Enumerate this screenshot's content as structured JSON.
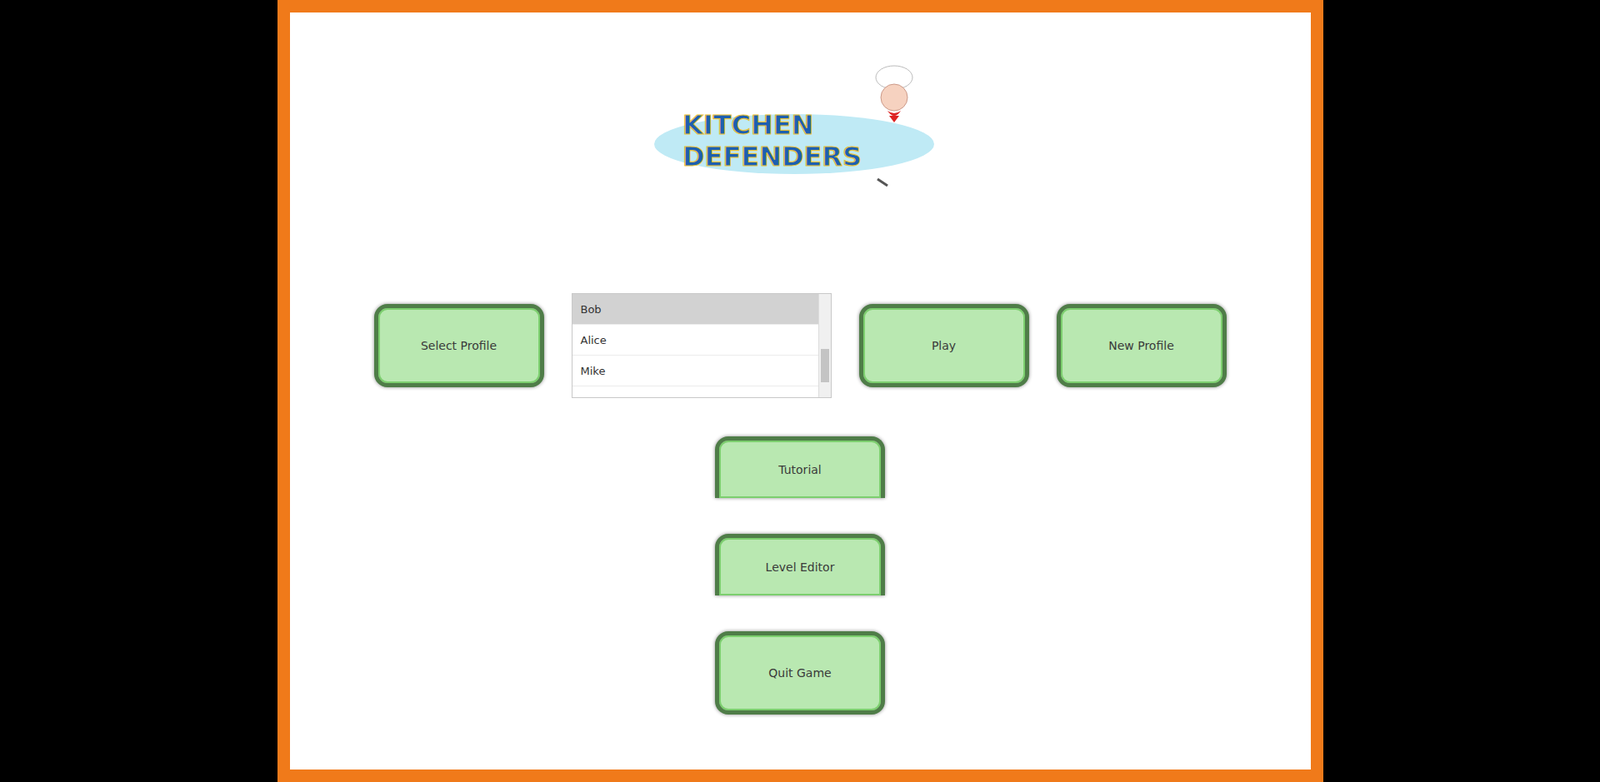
{
  "logo": {
    "lines": [
      "KITCHEN",
      "DEFENDERS"
    ]
  },
  "buttons": {
    "select_profile": "Select Profile",
    "play": "Play",
    "new_profile": "New Profile"
  },
  "profiles": [
    {
      "name": "Bob",
      "selected": true
    },
    {
      "name": "Alice",
      "selected": false
    },
    {
      "name": "Mike",
      "selected": false
    }
  ],
  "menu": [
    {
      "label": "Tutorial",
      "kind": "clipped"
    },
    {
      "label": "Level Editor",
      "kind": "clipped"
    },
    {
      "label": "Quit Game",
      "kind": "full"
    }
  ]
}
